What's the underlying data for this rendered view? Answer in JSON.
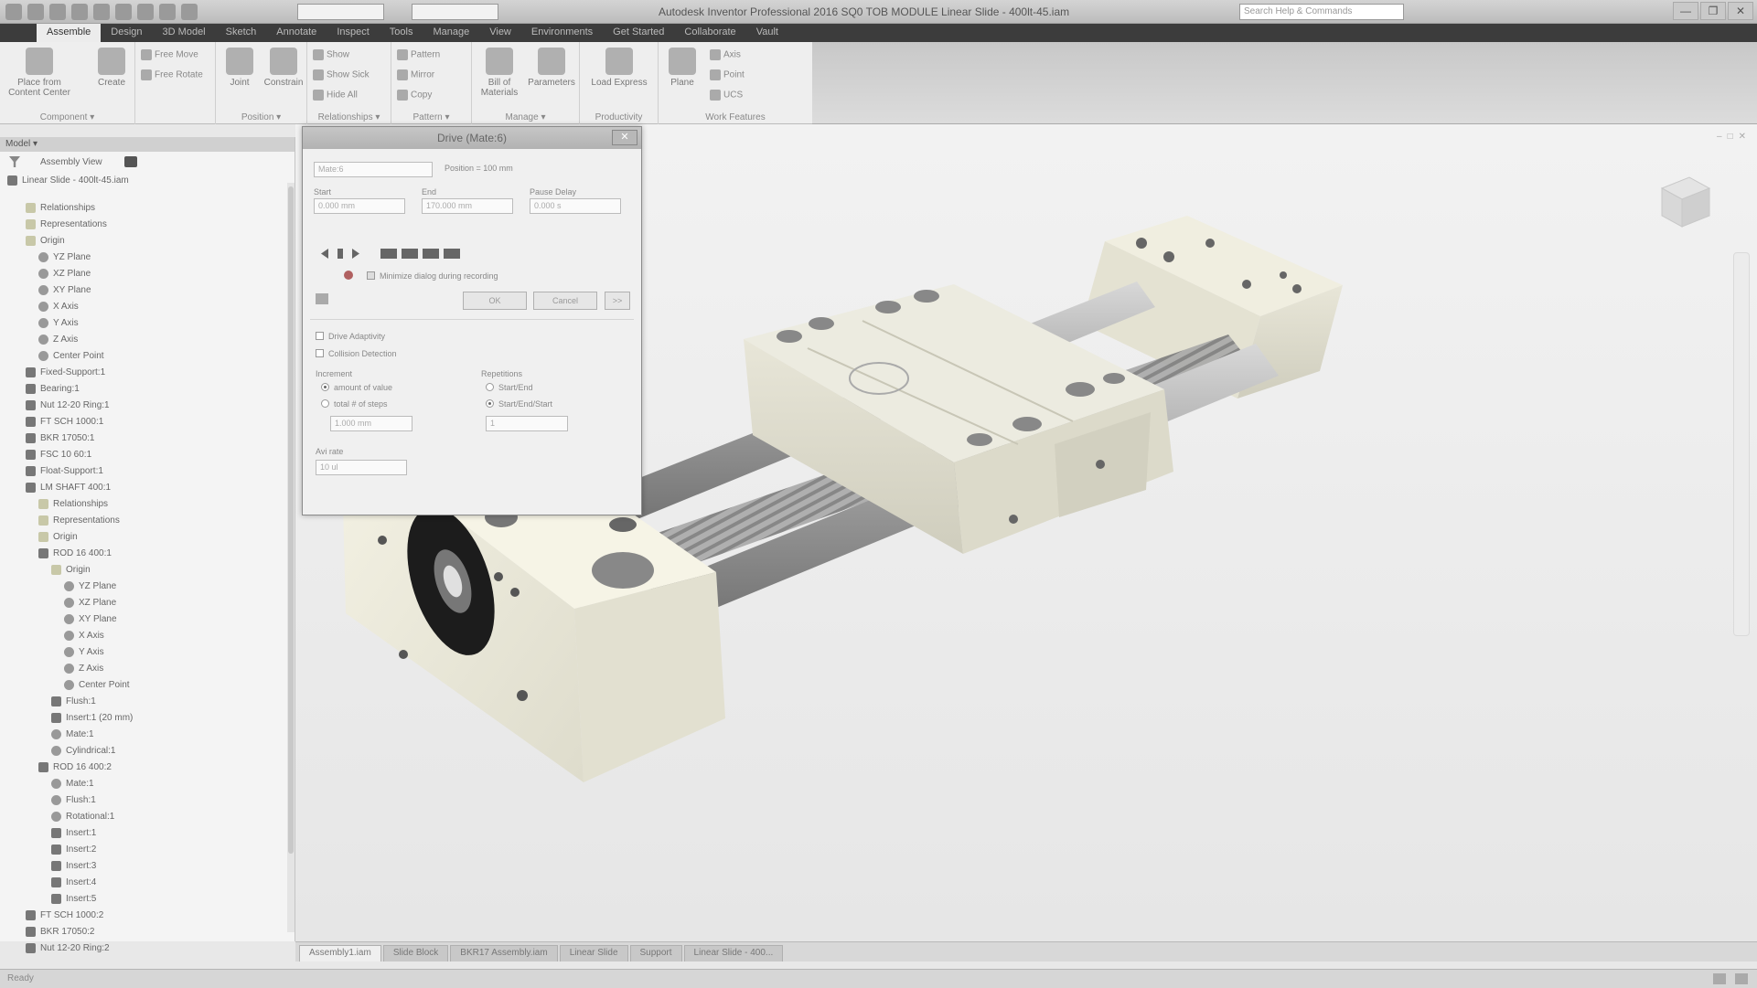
{
  "window": {
    "title": "Autodesk Inventor Professional 2016   SQ0 TOB MODULE   Linear Slide - 400lt-45.iam",
    "search_placeholder": "Search Help & Commands",
    "controls": [
      "—",
      "❐",
      "✕"
    ]
  },
  "ribbon": {
    "tabs": [
      "Assemble",
      "Design",
      "3D Model",
      "Sketch",
      "Annotate",
      "Inspect",
      "Tools",
      "Manage",
      "View",
      "Environments",
      "Get Started",
      "Collaborate",
      "Vault"
    ],
    "active_tab": "Assemble",
    "groups": [
      {
        "name": "Component ▾",
        "buttons": [
          "Place from Content Center",
          "Create"
        ],
        "small": [
          "Free Move",
          "Free Rotate"
        ]
      },
      {
        "name": "Position ▾",
        "buttons": [
          "Joint",
          "Constrain"
        ],
        "small": []
      },
      {
        "name": "Relationships ▾",
        "buttons": [],
        "small": [
          "Show",
          "Show Sick",
          "Hide All"
        ]
      },
      {
        "name": "Pattern ▾",
        "buttons": [],
        "small": [
          "Pattern",
          "Mirror",
          "Copy"
        ]
      },
      {
        "name": "Manage ▾",
        "buttons": [
          "Bill of Materials",
          "Parameters"
        ],
        "small": []
      },
      {
        "name": "Productivity",
        "buttons": [
          "Load Express"
        ],
        "small": []
      },
      {
        "name": "Work Features",
        "buttons": [
          "Plane"
        ],
        "small": [
          "Axis",
          "Point",
          "UCS"
        ]
      }
    ]
  },
  "browser": {
    "header": "Model ▾",
    "view_dropdown": "Assembly View",
    "root": "Linear Slide - 400lt-45.iam",
    "nodes": [
      {
        "label": "Relationships",
        "depth": 1,
        "icon": "folder"
      },
      {
        "label": "Representations",
        "depth": 1,
        "icon": "folder"
      },
      {
        "label": "Origin",
        "depth": 1,
        "icon": "folder"
      },
      {
        "label": "YZ Plane",
        "depth": 2,
        "icon": "feat"
      },
      {
        "label": "XZ Plane",
        "depth": 2,
        "icon": "feat"
      },
      {
        "label": "XY Plane",
        "depth": 2,
        "icon": "feat"
      },
      {
        "label": "X Axis",
        "depth": 2,
        "icon": "feat"
      },
      {
        "label": "Y Axis",
        "depth": 2,
        "icon": "feat"
      },
      {
        "label": "Z Axis",
        "depth": 2,
        "icon": "feat"
      },
      {
        "label": "Center Point",
        "depth": 2,
        "icon": "feat"
      },
      {
        "label": "Fixed-Support:1",
        "depth": 1,
        "icon": "part"
      },
      {
        "label": "Bearing:1",
        "depth": 1,
        "icon": "part"
      },
      {
        "label": "Nut 12-20 Ring:1",
        "depth": 1,
        "icon": "part"
      },
      {
        "label": "FT SCH 1000:1",
        "depth": 1,
        "icon": "part"
      },
      {
        "label": "BKR 17050:1",
        "depth": 1,
        "icon": "part"
      },
      {
        "label": "FSC 10 60:1",
        "depth": 1,
        "icon": "part"
      },
      {
        "label": "Float-Support:1",
        "depth": 1,
        "icon": "part"
      },
      {
        "label": "LM SHAFT 400:1",
        "depth": 1,
        "icon": "part"
      },
      {
        "label": "Relationships",
        "depth": 2,
        "icon": "folder"
      },
      {
        "label": "Representations",
        "depth": 2,
        "icon": "folder"
      },
      {
        "label": "Origin",
        "depth": 2,
        "icon": "folder"
      },
      {
        "label": "ROD 16 400:1",
        "depth": 2,
        "icon": "part"
      },
      {
        "label": "Origin",
        "depth": 3,
        "icon": "folder"
      },
      {
        "label": "YZ Plane",
        "depth": 4,
        "icon": "feat"
      },
      {
        "label": "XZ Plane",
        "depth": 4,
        "icon": "feat"
      },
      {
        "label": "XY Plane",
        "depth": 4,
        "icon": "feat"
      },
      {
        "label": "X Axis",
        "depth": 4,
        "icon": "feat"
      },
      {
        "label": "Y Axis",
        "depth": 4,
        "icon": "feat"
      },
      {
        "label": "Z Axis",
        "depth": 4,
        "icon": "feat"
      },
      {
        "label": "Center Point",
        "depth": 4,
        "icon": "feat"
      },
      {
        "label": "Flush:1",
        "depth": 3,
        "icon": "part"
      },
      {
        "label": "Insert:1 (20 mm)",
        "depth": 3,
        "icon": "part"
      },
      {
        "label": "Mate:1",
        "depth": 3,
        "icon": "feat"
      },
      {
        "label": "Cylindrical:1",
        "depth": 3,
        "icon": "feat"
      },
      {
        "label": "ROD 16 400:2",
        "depth": 2,
        "icon": "part"
      },
      {
        "label": "Mate:1",
        "depth": 3,
        "icon": "feat"
      },
      {
        "label": "Flush:1",
        "depth": 3,
        "icon": "feat"
      },
      {
        "label": "Rotational:1",
        "depth": 3,
        "icon": "feat"
      },
      {
        "label": "Insert:1",
        "depth": 3,
        "icon": "part"
      },
      {
        "label": "Insert:2",
        "depth": 3,
        "icon": "part"
      },
      {
        "label": "Insert:3",
        "depth": 3,
        "icon": "part"
      },
      {
        "label": "Insert:4",
        "depth": 3,
        "icon": "part"
      },
      {
        "label": "Insert:5",
        "depth": 3,
        "icon": "part"
      },
      {
        "label": "FT SCH 1000:2",
        "depth": 1,
        "icon": "part"
      },
      {
        "label": "BKR 17050:2",
        "depth": 1,
        "icon": "part"
      },
      {
        "label": "Nut 12-20 Ring:2",
        "depth": 1,
        "icon": "part"
      }
    ]
  },
  "dialog": {
    "title": "Drive (Mate:6)",
    "constraint_label": "Mate:6",
    "constraint_value": "Position = 100 mm",
    "start_label": "Start",
    "start_value": "0.000 mm",
    "end_label": "End",
    "end_value": "170.000 mm",
    "pause_label": "Pause Delay",
    "pause_value": "0.000 s",
    "record_label": "Minimize dialog during recording",
    "ok": "OK",
    "cancel": "Cancel",
    "more": ">>",
    "drive_adaptivity": "Drive Adaptivity",
    "collision_detection": "Collision Detection",
    "increment_title": "Increment",
    "amount_label": "amount of value",
    "total_label": "total # of steps",
    "increment_value": "1.000 mm",
    "repetitions_title": "Repetitions",
    "start_end": "Start/End",
    "start_end_start": "Start/End/Start",
    "repetitions_value": "1",
    "avi_label": "Avi rate",
    "avi_value": "10 ul"
  },
  "doc_tabs": [
    "Assembly1.iam",
    "Slide Block",
    "BKR17 Assembly.iam",
    "Linear Slide",
    "Support",
    "Linear Slide - 400..."
  ],
  "status": "Ready",
  "colors": {
    "accent": "#3c3c3c",
    "part_cream": "#eceadb",
    "part_shadow": "#cfcdbd",
    "shaft_gray": "#9c9c9c"
  }
}
